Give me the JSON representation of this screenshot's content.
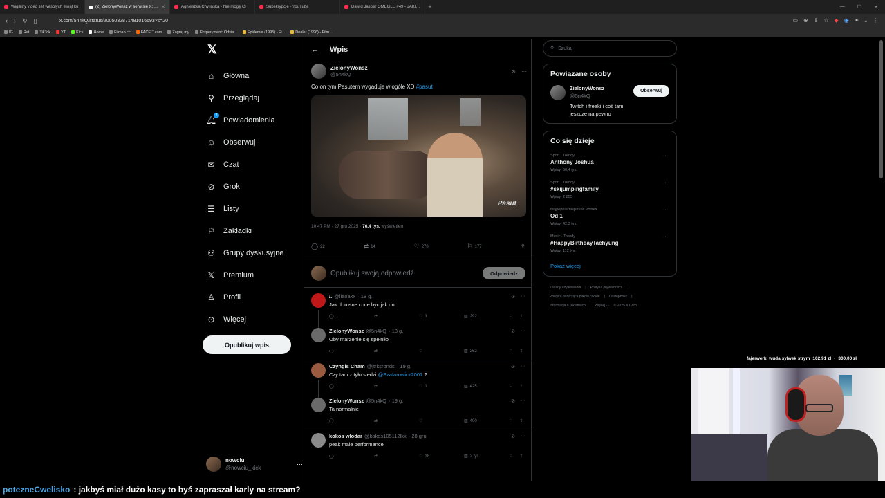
{
  "browser": {
    "tabs": [
      {
        "title": "Wigilijny video set wesołych świąt ku",
        "active": false,
        "favicon": "youtube-icon"
      },
      {
        "title": "(2) ZielonyWonsz w serwisie X: \"Co",
        "active": true,
        "favicon": "x-icon"
      },
      {
        "title": "Agnieszka Chylińska - Nie mogę Ci",
        "active": false,
        "favicon": "youtube-icon"
      },
      {
        "title": "Subskrypcje - YouTube",
        "active": false,
        "favicon": "youtube-icon"
      },
      {
        "title": "Dawid Jasper OMEGLE #49 - JAKIE ti",
        "active": false,
        "favicon": "youtube-icon"
      }
    ],
    "url": "x.com/5n4kQ/status/2005032871481016693?s=20",
    "bookmarks": [
      "IG",
      "Rat",
      "TikTok",
      "YT",
      "Kick",
      "Home",
      "Filman.cc",
      "FACEIT.com",
      "Zagraj.my",
      "Eksperyment: Odsia...",
      "Epidemia (1995) - Fi...",
      "Dealer (1996) - Film..."
    ]
  },
  "sidebar": {
    "items": [
      {
        "label": "Główna",
        "icon": "home-icon"
      },
      {
        "label": "Przeglądaj",
        "icon": "search-icon"
      },
      {
        "label": "Powiadomienia",
        "icon": "bell-icon",
        "badge": "2"
      },
      {
        "label": "Obserwuj",
        "icon": "follow-icon"
      },
      {
        "label": "Czat",
        "icon": "mail-icon"
      },
      {
        "label": "Grok",
        "icon": "grok-icon"
      },
      {
        "label": "Listy",
        "icon": "list-icon"
      },
      {
        "label": "Zakładki",
        "icon": "bookmark-icon"
      },
      {
        "label": "Grupy dyskusyjne",
        "icon": "groups-icon"
      },
      {
        "label": "Premium",
        "icon": "x-icon"
      },
      {
        "label": "Profil",
        "icon": "profile-icon"
      },
      {
        "label": "Więcej",
        "icon": "more-icon"
      }
    ],
    "post_button": "Opublikuj wpis",
    "account": {
      "name": "nowciu",
      "handle": "@nowciu_kick"
    }
  },
  "main": {
    "title": "Wpis",
    "post": {
      "author": "ZielonyWonsz",
      "handle": "@5n4kQ",
      "text": "Co on tym Pasutem wygaduje w ogóle XD ",
      "hashtag": "#pasut",
      "watermark": "Pasut",
      "time": "10:47 PM · 27 gru 2025 · ",
      "views": "76,4 tys.",
      "views_label": " wyświetleń",
      "stats": {
        "replies": "22",
        "reposts": "14",
        "likes": "270",
        "bookmarks": "177"
      }
    },
    "reply_placeholder": "Opublikuj swoją odpowiedź",
    "reply_button": "Odpowiedz",
    "replies": [
      {
        "name": "/.",
        "handle": "@liaoaxx",
        "time": "· 18 g.",
        "text": "Jak dorosne chce byc jak on",
        "mention": "",
        "text_after": "",
        "stats": [
          "1",
          "",
          "3",
          "292"
        ],
        "avatar_color": "#c01818"
      },
      {
        "name": "ZielonyWonsz",
        "handle": "@5n4kQ",
        "time": "· 18 g.",
        "text": "Oby marzenie się spełniło",
        "mention": "",
        "text_after": "",
        "stats": [
          "",
          "",
          "",
          "262"
        ],
        "avatar_color": "#6a6a6a"
      },
      {
        "name": "Czyngis Cham",
        "handle": "@jtrksrbnds",
        "time": "· 19 g.",
        "text": "Czy tam z tyłu siedzi ",
        "mention": "@Szafarowicz2001",
        "text_after": " ?",
        "stats": [
          "1",
          "",
          "1",
          "425"
        ],
        "avatar_color": "#9a5a40"
      },
      {
        "name": "ZielonyWonsz",
        "handle": "@5n4kQ",
        "time": "· 19 g.",
        "text": "Ta normalnie",
        "mention": "",
        "text_after": "",
        "stats": [
          "",
          "",
          "",
          "400"
        ],
        "avatar_color": "#6a6a6a"
      },
      {
        "name": "kokos włodar",
        "handle": "@kokos105112lkk",
        "time": "· 28 gru",
        "text": "peak male performance",
        "mention": "",
        "text_after": "",
        "stats": [
          "",
          "",
          "18",
          "2 tys."
        ],
        "avatar_color": "#8a8a8a"
      }
    ]
  },
  "right": {
    "search_placeholder": "Szukaj",
    "related": {
      "title": "Powiązane osoby",
      "name": "ZielonyWonsz",
      "handle": "@5n4kQ",
      "bio": "Twitch i freaki i coś tam jeszcze na pewno",
      "follow": "Obserwuj"
    },
    "trends": {
      "title": "Co się dzieje",
      "items": [
        {
          "category": "Sport · Trendy",
          "topic": "Anthony Joshua",
          "posts": "Wpisy: 58,4 tys."
        },
        {
          "category": "Sport · Trendy",
          "topic": "#skijumpingfamily",
          "posts": "Wpisy: 2 855"
        },
        {
          "category": "Najpopularniejsze w Polska",
          "topic": "Od 1",
          "posts": "Wpisy: 42,3 tys."
        },
        {
          "category": "Music · Trendy",
          "topic": "#HappyBirthdayTaehyung",
          "posts": "Wpisy: 112 tys."
        }
      ],
      "show_more": "Pokaż więcej"
    },
    "footer": {
      "line1": [
        "Zasady użytkowania",
        "|",
        "Polityka prywatności",
        "|"
      ],
      "line2": [
        "Polityka dotycząca plików cookie",
        "|",
        "Dostępność",
        "|"
      ],
      "line3": [
        "Informacja o reklamach",
        "|",
        "Więcej ···",
        "© 2025 X Corp."
      ]
    }
  },
  "stream": {
    "donation": {
      "label": "fajerwerki wuda sylwek strym",
      "amount1": "102,91 zł",
      "separator": "·",
      "amount2": "300,00 zł"
    },
    "chat": {
      "user": "potezneCwelisko",
      "message": ": jakbyś miał dużo kasy to byś zapraszał karly na stream?"
    }
  },
  "colors": {
    "background": "#000000",
    "accent": "#1d9bf0",
    "border": "#2f3336",
    "muted": "#71767b"
  }
}
